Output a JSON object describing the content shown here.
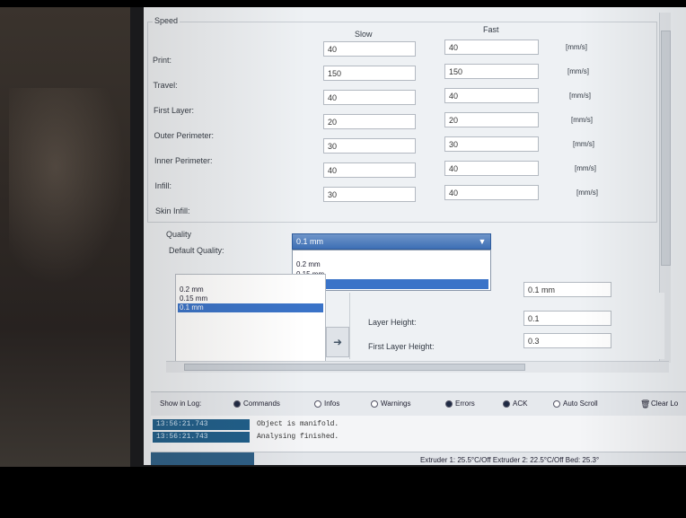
{
  "speed": {
    "group_label": "Speed",
    "col_slow": "Slow",
    "col_fast": "Fast",
    "rows": [
      {
        "label": "Print:",
        "slow": "40",
        "fast": "40",
        "unit": "[mm/s]"
      },
      {
        "label": "Travel:",
        "slow": "150",
        "fast": "150",
        "unit": "[mm/s]"
      },
      {
        "label": "First Layer:",
        "slow": "40",
        "fast": "40",
        "unit": "[mm/s]"
      },
      {
        "label": "Outer Perimeter:",
        "slow": "20",
        "fast": "20",
        "unit": "[mm/s]"
      },
      {
        "label": "Inner Perimeter:",
        "slow": "30",
        "fast": "30",
        "unit": "[mm/s]"
      },
      {
        "label": "Infill:",
        "slow": "40",
        "fast": "40",
        "unit": "[mm/s]"
      },
      {
        "label": "Skin Infill:",
        "slow": "30",
        "fast": "40",
        "unit": "[mm/s]"
      }
    ]
  },
  "quality": {
    "group_label": "Quality",
    "default_label": "Default Quality:",
    "selected": "0.1 mm",
    "options": [
      "0.2 mm",
      "0.15 mm",
      "0.1 mm"
    ],
    "list_items": [
      "0.2 mm",
      "0.15 mm",
      "0.1 mm"
    ],
    "name_value": "0.1 mm",
    "layer_height_label": "Layer Height:",
    "layer_height_value": "0.1",
    "first_layer_height_label": "First Layer Height:",
    "first_layer_height_value": "0.3"
  },
  "log_bar": {
    "show_in_log": "Show in Log:",
    "options": [
      {
        "label": "Commands",
        "checked": true
      },
      {
        "label": "Infos",
        "checked": false
      },
      {
        "label": "Warnings",
        "checked": false
      },
      {
        "label": "Errors",
        "checked": true
      },
      {
        "label": "ACK",
        "checked": true
      },
      {
        "label": "Auto Scroll",
        "checked": false
      }
    ],
    "clear_label": "Clear Lo"
  },
  "log": [
    {
      "time": "13:56:21.743",
      "message": "Object is manifold."
    },
    {
      "time": "13:56:21.743",
      "message": "Analysing finished."
    }
  ],
  "status": {
    "temps": "Extruder 1: 25.5°C/Off Extruder 2: 22.5°C/Off Bed: 25.3°"
  }
}
